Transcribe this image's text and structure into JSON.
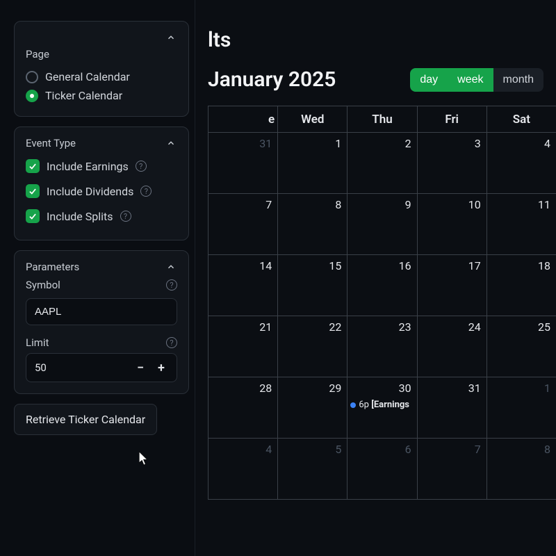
{
  "sidebar": {
    "page_section_label": "Page",
    "page_options": {
      "general": "General Calendar",
      "ticker": "Ticker Calendar"
    },
    "event_type_label": "Event Type",
    "event_types": {
      "earnings": "Include Earnings",
      "dividends": "Include Dividends",
      "splits": "Include Splits"
    },
    "parameters_label": "Parameters",
    "symbol_label": "Symbol",
    "symbol_value": "AAPL",
    "limit_label": "Limit",
    "limit_value": "50",
    "retrieve_button": "Retrieve Ticker Calendar"
  },
  "main": {
    "title_partial": "lts",
    "month_title": "January 2025",
    "views": {
      "day": "day",
      "week": "week",
      "month": "month"
    },
    "day_headers": [
      "e",
      "Wed",
      "Thu",
      "Fri",
      "Sat"
    ],
    "weeks": [
      [
        {
          "n": "31",
          "muted": true
        },
        {
          "n": "1"
        },
        {
          "n": "2"
        },
        {
          "n": "3"
        },
        {
          "n": "4"
        }
      ],
      [
        {
          "n": "7"
        },
        {
          "n": "8"
        },
        {
          "n": "9"
        },
        {
          "n": "10"
        },
        {
          "n": "11"
        }
      ],
      [
        {
          "n": "14"
        },
        {
          "n": "15"
        },
        {
          "n": "16"
        },
        {
          "n": "17"
        },
        {
          "n": "18"
        }
      ],
      [
        {
          "n": "21"
        },
        {
          "n": "22"
        },
        {
          "n": "23"
        },
        {
          "n": "24"
        },
        {
          "n": "25"
        }
      ],
      [
        {
          "n": "28"
        },
        {
          "n": "29"
        },
        {
          "n": "30",
          "event": {
            "time": "6p",
            "label": "[Earnings"
          }
        },
        {
          "n": "31"
        },
        {
          "n": "1",
          "muted": true
        }
      ],
      [
        {
          "n": "4",
          "muted": true
        },
        {
          "n": "5",
          "muted": true
        },
        {
          "n": "6",
          "muted": true
        },
        {
          "n": "7",
          "muted": true
        },
        {
          "n": "8",
          "muted": true
        }
      ]
    ]
  }
}
